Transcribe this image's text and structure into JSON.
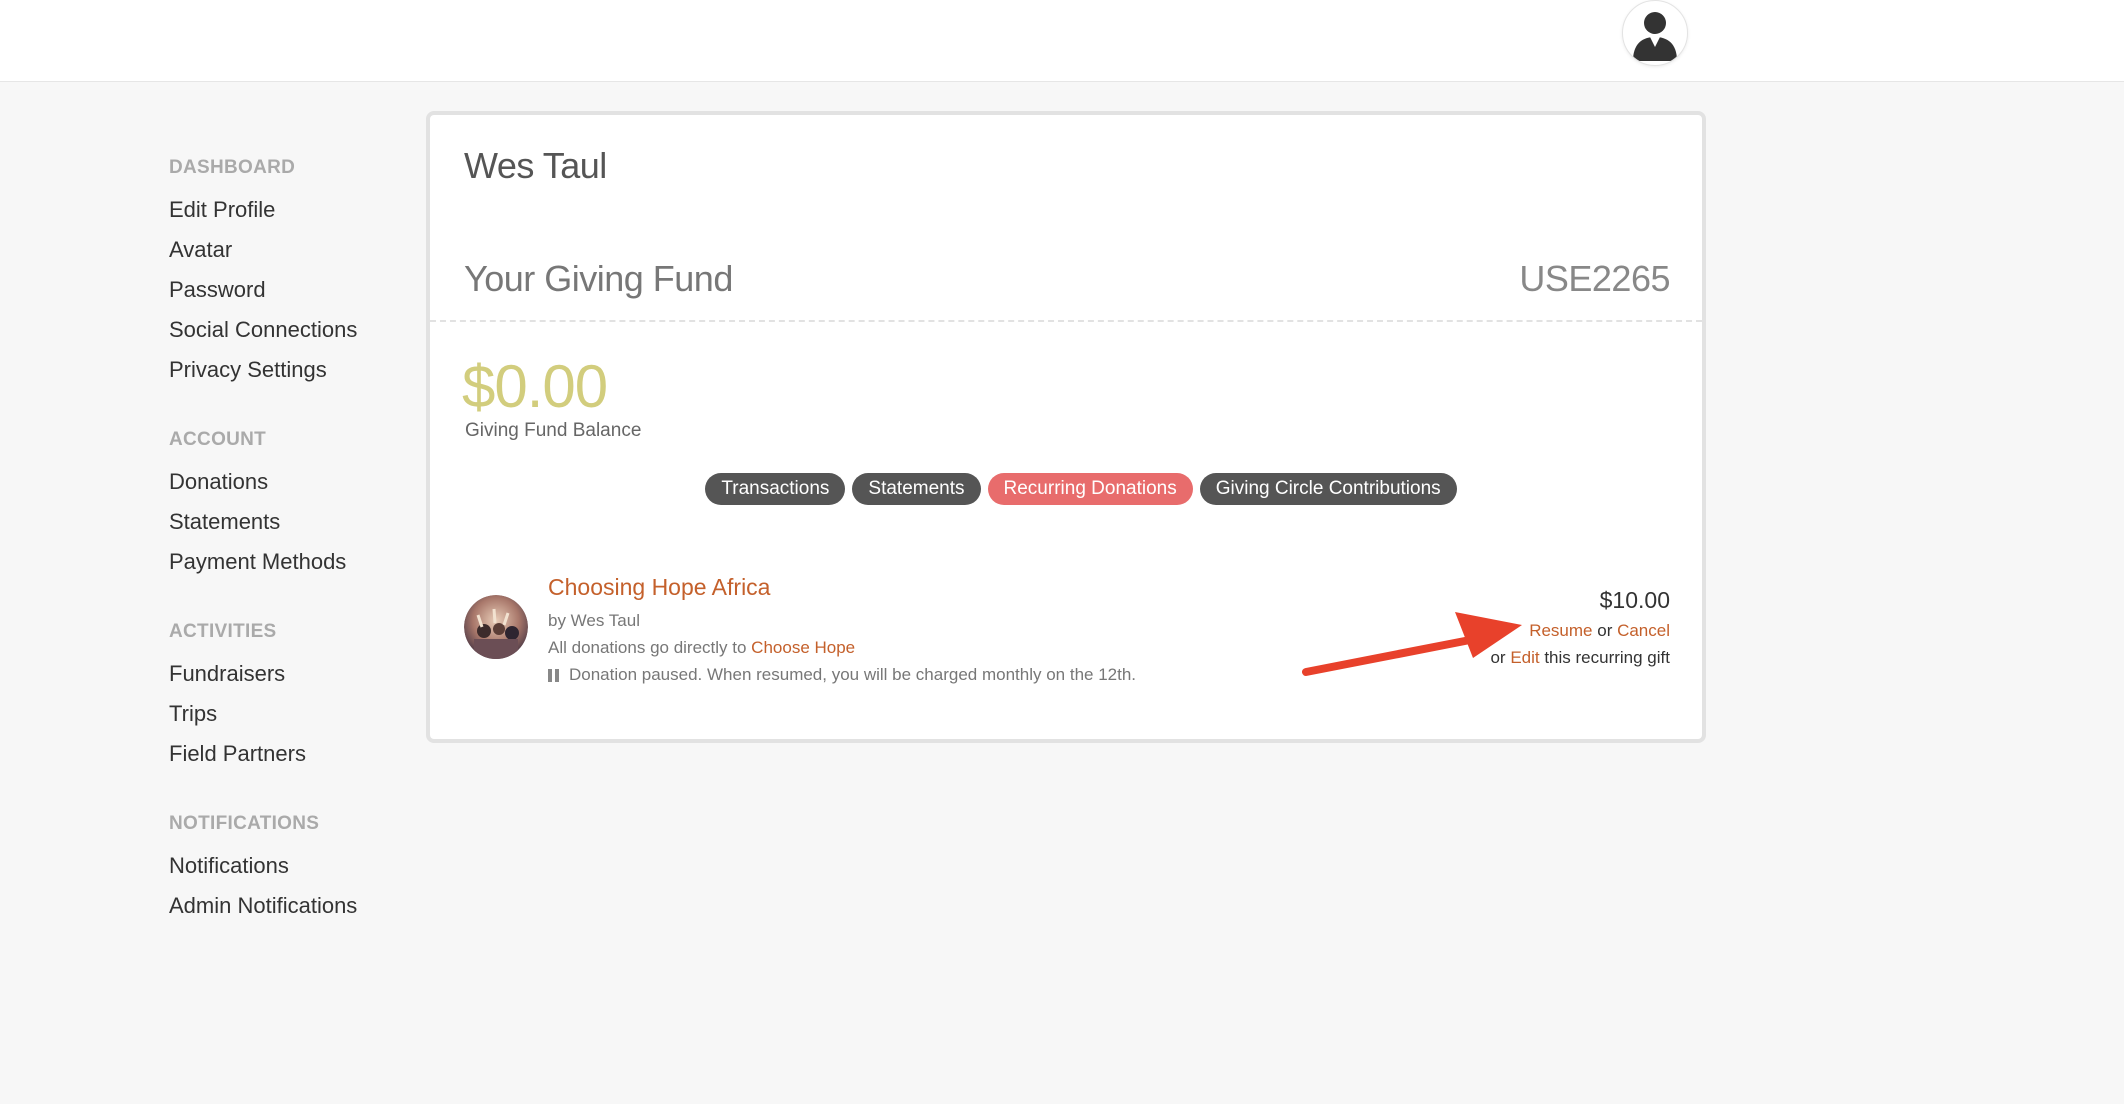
{
  "sidebar": {
    "groups": [
      {
        "heading": "DASHBOARD",
        "items": [
          "Edit Profile",
          "Avatar",
          "Password",
          "Social Connections",
          "Privacy Settings"
        ]
      },
      {
        "heading": "ACCOUNT",
        "items": [
          "Donations",
          "Statements",
          "Payment Methods"
        ]
      },
      {
        "heading": "ACTIVITIES",
        "items": [
          "Fundraisers",
          "Trips",
          "Field Partners"
        ]
      },
      {
        "heading": "NOTIFICATIONS",
        "items": [
          "Notifications",
          "Admin Notifications"
        ]
      }
    ]
  },
  "card": {
    "name": "Wes Taul",
    "fund_title": "Your Giving Fund",
    "fund_code": "USE2265",
    "balance": "$0.00",
    "balance_label": "Giving Fund Balance"
  },
  "tabs": [
    {
      "label": "Transactions",
      "active": false
    },
    {
      "label": "Statements",
      "active": false
    },
    {
      "label": "Recurring Donations",
      "active": true
    },
    {
      "label": "Giving Circle Contributions",
      "active": false
    }
  ],
  "donation": {
    "title": "Choosing Hope Africa",
    "by": "by Wes Taul",
    "direct_prefix": "All donations go directly to ",
    "direct_link": "Choose Hope",
    "status": "Donation paused. When resumed, you will be charged monthly on the 12th.",
    "amount": "$10.00",
    "resume": "Resume",
    "or1": " or ",
    "cancel": "Cancel",
    "or2": "or ",
    "edit": "Edit",
    "edit_suffix": " this recurring gift"
  },
  "colors": {
    "accent_link": "#c4602b",
    "active_tab": "#e86c6c",
    "tab": "#555555",
    "balance": "#d2cd7d",
    "arrow": "#e8412b"
  }
}
